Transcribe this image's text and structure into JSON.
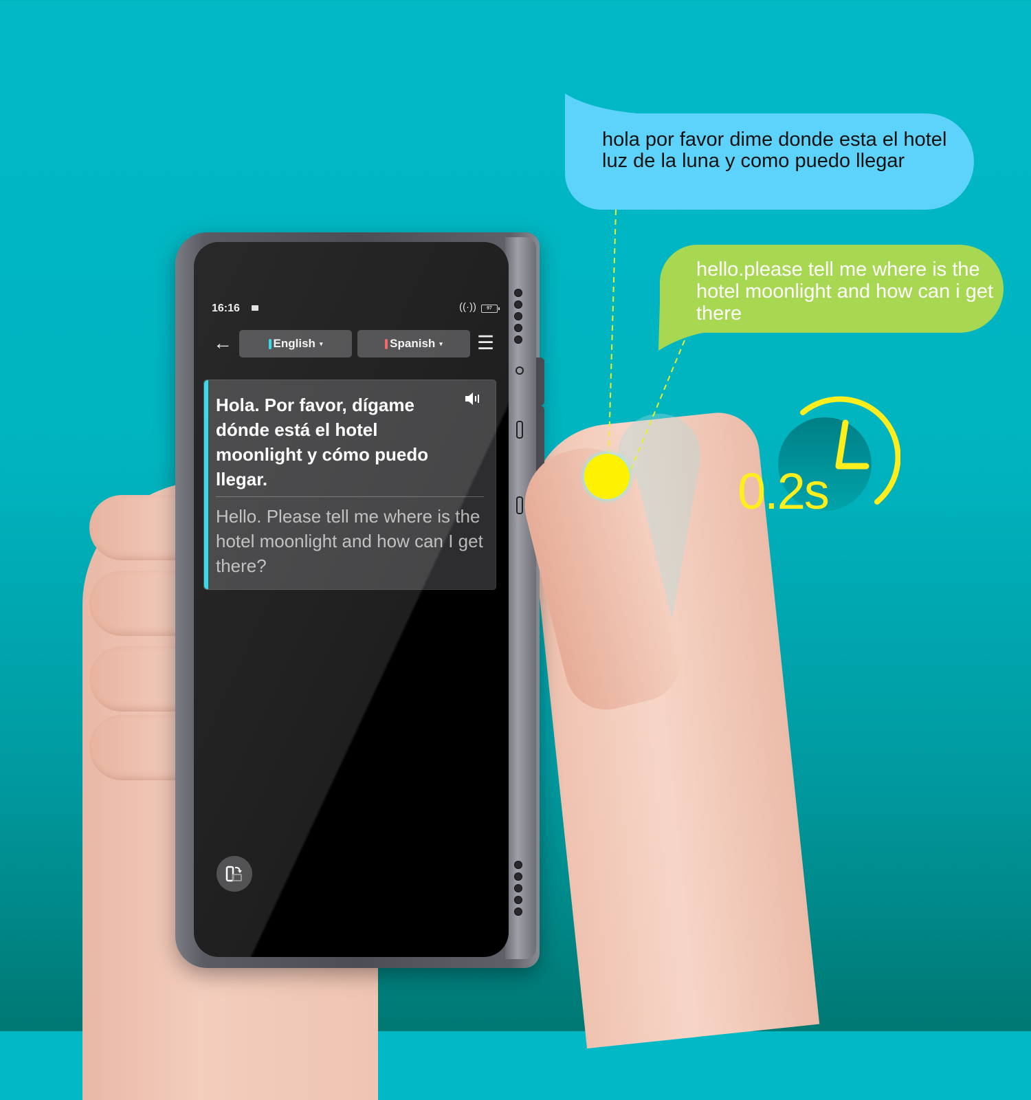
{
  "device": {
    "status_bar": {
      "time": "16:16",
      "battery_level": "97",
      "icons": [
        "image-notification-icon",
        "hotspot-signal-icon",
        "battery-icon"
      ]
    },
    "nav": {
      "back_icon": "←",
      "source_language": "English",
      "target_language": "Spanish",
      "caret": "▾",
      "menu_icon": "☰",
      "source_marker_color": "#13d5e8",
      "target_marker_color": "#f0525a"
    },
    "translation_card": {
      "translated_text": "Hola. Por favor, dígame dónde está el hotel moonlight y cómo puedo llegar.",
      "original_text": "Hello. Please tell me where is the hotel moonlight and how can I get there?",
      "speaker_icon": "🔊",
      "accent_color": "#13d5e8"
    },
    "rotate_button_icon": "rotate-screen-icon"
  },
  "bubbles": {
    "spanish_speech": "hola por favor dime donde esta el hotel luz de la luna y como puedo llegar",
    "english_speech": "hello.please tell me where is the hotel moonlight and how can i get there"
  },
  "timer": {
    "value": "0.2s",
    "color": "#ffee1e"
  },
  "colors": {
    "background_top": "#00b9c5",
    "background_bottom": "#007873",
    "blue_bubble": "#5dd3fb",
    "green_bubble": "#a8d752",
    "tap_dot": "#fff200"
  }
}
